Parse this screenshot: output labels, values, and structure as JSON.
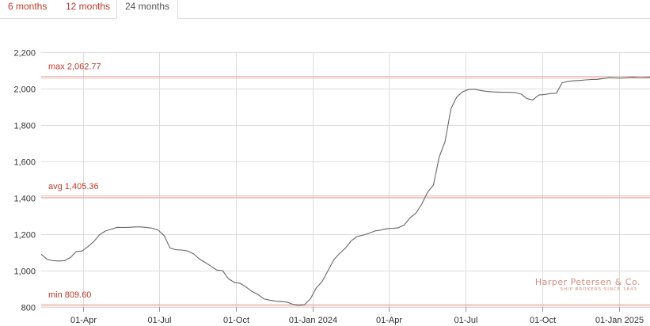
{
  "tabs": [
    {
      "label": "6 months",
      "active": false
    },
    {
      "label": "12 months",
      "active": false
    },
    {
      "label": "24 months",
      "active": true
    }
  ],
  "colors": {
    "accent": "#c0392b",
    "line": "#666666",
    "grid": "#dddddd",
    "reference": "#e8b5ad"
  },
  "watermark": {
    "name": "Harper Petersen & Co.",
    "tagline": "SHIP BROKERS SINCE 1843"
  },
  "chart_data": {
    "type": "line",
    "x_axis": "date",
    "ylim": [
      800,
      2200
    ],
    "yticks": [
      800,
      1000,
      1200,
      1400,
      1600,
      1800,
      2000,
      2200
    ],
    "ytick_labels": [
      "800",
      "1,000",
      "1,200",
      "1,400",
      "1,600",
      "1,800",
      "2,000",
      "2,200"
    ],
    "xtick_labels": [
      "01-Apr",
      "01-Jul",
      "01-Oct",
      "01-Jan 2024",
      "01-Apr",
      "01-Jul",
      "01-Oct",
      "01-Jan 2025"
    ],
    "xtick_dates": [
      "2023-04-01",
      "2023-07-01",
      "2023-10-01",
      "2024-01-01",
      "2024-04-01",
      "2024-07-01",
      "2024-10-01",
      "2025-01-01"
    ],
    "grid": true,
    "reference_lines": [
      {
        "label": "max 2,062.77",
        "value": 2062.77
      },
      {
        "label": "avg 1,405.36",
        "value": 1405.36
      },
      {
        "label": "min 809.60",
        "value": 809.6
      }
    ],
    "series": [
      {
        "x": [
          "2023-02-10",
          "2023-02-17",
          "2023-02-24",
          "2023-03-03",
          "2023-03-10",
          "2023-03-17",
          "2023-03-24",
          "2023-03-31",
          "2023-04-07",
          "2023-04-14",
          "2023-04-21",
          "2023-04-28",
          "2023-05-05",
          "2023-05-12",
          "2023-05-19",
          "2023-05-26",
          "2023-06-02",
          "2023-06-09",
          "2023-06-16",
          "2023-06-23",
          "2023-06-30",
          "2023-07-07",
          "2023-07-14",
          "2023-07-21",
          "2023-07-28",
          "2023-08-04",
          "2023-08-11",
          "2023-08-18",
          "2023-08-25",
          "2023-09-01",
          "2023-09-08",
          "2023-09-15",
          "2023-09-22",
          "2023-09-29",
          "2023-10-06",
          "2023-10-13",
          "2023-10-20",
          "2023-10-27",
          "2023-11-03",
          "2023-11-10",
          "2023-11-17",
          "2023-11-24",
          "2023-12-01",
          "2023-12-08",
          "2023-12-15",
          "2023-12-22",
          "2023-12-29",
          "2024-01-05",
          "2024-01-12",
          "2024-01-19",
          "2024-01-26",
          "2024-02-02",
          "2024-02-09",
          "2024-02-16",
          "2024-02-23",
          "2024-03-01",
          "2024-03-08",
          "2024-03-15",
          "2024-03-22",
          "2024-03-29",
          "2024-04-05",
          "2024-04-12",
          "2024-04-19",
          "2024-04-26",
          "2024-05-03",
          "2024-05-10",
          "2024-05-17",
          "2024-05-24",
          "2024-05-31",
          "2024-06-07",
          "2024-06-14",
          "2024-06-21",
          "2024-06-28",
          "2024-07-05",
          "2024-07-12",
          "2024-07-19",
          "2024-07-26",
          "2024-08-02",
          "2024-08-09",
          "2024-08-16",
          "2024-08-23",
          "2024-08-30",
          "2024-09-06",
          "2024-09-13",
          "2024-09-20",
          "2024-09-27",
          "2024-10-04",
          "2024-10-11",
          "2024-10-18",
          "2024-10-25",
          "2024-11-01",
          "2024-11-08",
          "2024-11-15",
          "2024-11-22",
          "2024-11-29",
          "2024-12-06",
          "2024-12-13",
          "2024-12-20",
          "2024-12-27",
          "2025-01-03",
          "2025-01-10",
          "2025-01-17",
          "2025-01-24",
          "2025-01-31",
          "2025-02-07"
        ],
        "values": [
          1090,
          1062,
          1055,
          1053,
          1055,
          1072,
          1105,
          1108,
          1132,
          1160,
          1198,
          1218,
          1228,
          1238,
          1237,
          1238,
          1240,
          1240,
          1237,
          1233,
          1222,
          1192,
          1125,
          1115,
          1113,
          1108,
          1093,
          1065,
          1045,
          1025,
          1003,
          1000,
          955,
          935,
          930,
          910,
          885,
          870,
          845,
          838,
          832,
          830,
          827,
          815,
          809.6,
          813,
          845,
          905,
          940,
          1000,
          1060,
          1095,
          1125,
          1165,
          1188,
          1195,
          1205,
          1218,
          1223,
          1230,
          1232,
          1235,
          1250,
          1290,
          1315,
          1365,
          1430,
          1470,
          1625,
          1710,
          1890,
          1955,
          1983,
          1995,
          1997,
          1990,
          1985,
          1982,
          1981,
          1980,
          1980,
          1978,
          1970,
          1945,
          1938,
          1965,
          1968,
          1973,
          1975,
          2032,
          2040,
          2043,
          2045,
          2048,
          2050,
          2051,
          2055,
          2060,
          2059,
          2058,
          2060,
          2062.77,
          2061,
          2060,
          2062
        ]
      }
    ]
  }
}
